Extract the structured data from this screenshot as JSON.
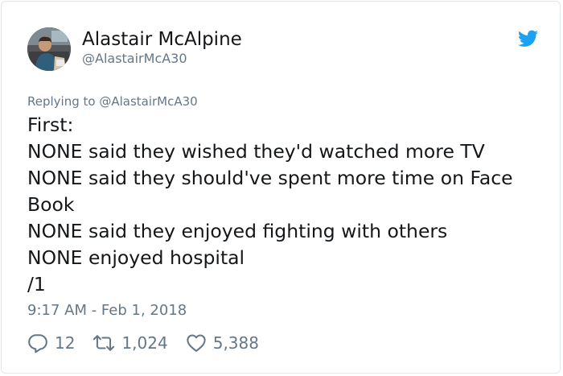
{
  "author": {
    "name": "Alastair McAlpine",
    "handle": "@AlastairMcA30",
    "avatar": "profile-photo"
  },
  "reply_context": {
    "text": "Replying to @AlastairMcA30"
  },
  "tweet": {
    "lines": [
      "First:",
      "NONE said they wished they'd watched more TV",
      "NONE said they should've spent more time on Face",
      "Book",
      "NONE said they enjoyed fighting with others",
      "NONE enjoyed hospital",
      "/1"
    ],
    "timestamp": "9:17 AM - Feb 1, 2018"
  },
  "actions": {
    "replies": "12",
    "retweets": "1,024",
    "likes": "5,388"
  },
  "icons": {
    "brand": "twitter-bird-icon",
    "reply": "reply-bubble-icon",
    "retweet": "retweet-icon",
    "like": "heart-icon"
  },
  "colors": {
    "twitter_blue": "#1da1f2",
    "text_primary": "#14171a",
    "text_secondary": "#657786",
    "border": "#e1e8ed"
  }
}
